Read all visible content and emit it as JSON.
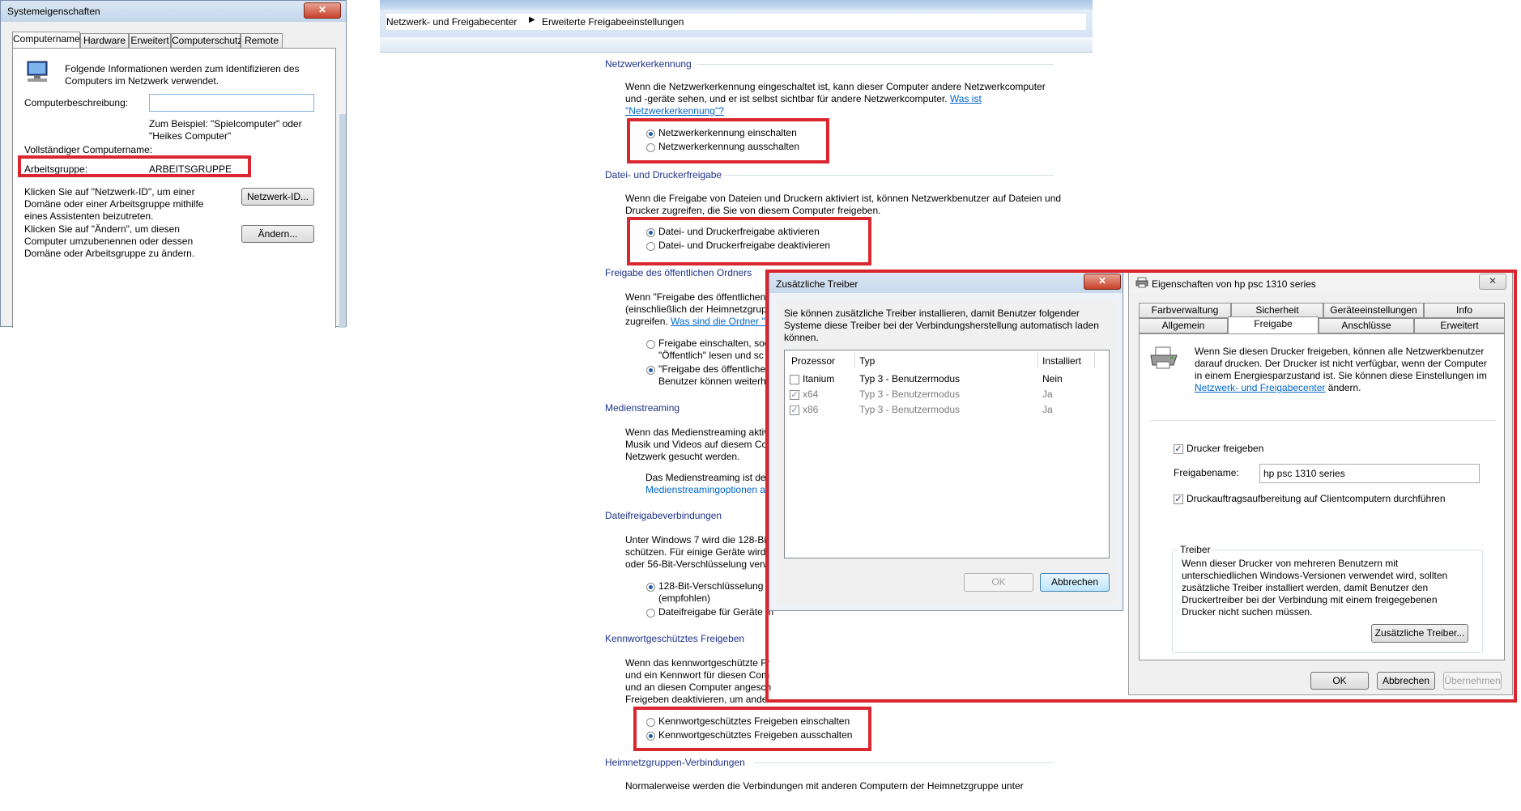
{
  "sys": {
    "title": "Systemeigenschaften",
    "close": "✕",
    "tabs": [
      "Computername",
      "Hardware",
      "Erweitert",
      "Computerschutz",
      "Remote"
    ],
    "info": "Folgende Informationen werden zum Identifizieren des Computers im Netzwerk verwendet.",
    "desc_label": "Computerbeschreibung:",
    "desc_value": "",
    "example": "Zum Beispiel: \"Spielcomputer\" oder \"Heikes Computer\"",
    "fullname_label": "Vollständiger Computername:",
    "workgroup_label": "Arbeitsgruppe:",
    "workgroup_value": "ARBEITSGRUPPE",
    "netid_text": "Klicken Sie auf \"Netzwerk-ID\", um einer Domäne oder einer Arbeitsgruppe mithilfe eines Assistenten beizutreten.",
    "netid_button": "Netzwerk-ID...",
    "change_text": "Klicken Sie auf \"Ändern\", um diesen Computer umzubenennen oder dessen Domäne oder Arbeitsgruppe zu ändern.",
    "change_button": "Ändern..."
  },
  "net": {
    "breadcrumb1": "Netzwerk- und Freigabecenter",
    "breadcrumb2": "Erweiterte Freigabeeinstellungen",
    "s1_title": "Netzwerkerkennung",
    "s1_text": "Wenn die Netzwerkerkennung eingeschaltet ist, kann dieser Computer andere Netzwerkcomputer und -geräte sehen, und er ist selbst sichtbar für andere Netzwerkcomputer.",
    "s1_link1": "Was ist",
    "s1_link2": "\"Netzwerkerkennung\"?",
    "s1_opt1": "Netzwerkerkennung einschalten",
    "s1_opt2": "Netzwerkerkennung ausschalten",
    "s2_title": "Datei- und Druckerfreigabe",
    "s2_text": "Wenn die Freigabe von Dateien und Druckern aktiviert ist, können Netzwerkbenutzer auf Dateien und Drucker zugreifen, die Sie von diesem Computer freigeben.",
    "s2_opt1": "Datei- und Druckerfreigabe aktivieren",
    "s2_opt2": "Datei- und Druckerfreigabe deaktivieren",
    "s3_title": "Freigabe des öffentlichen Ordners",
    "s3_l1": "Wenn \"Freigabe des öffentlichen",
    "s3_l2": "(einschließlich der Heimnetzgrup",
    "s3_l3": "zugreifen.",
    "s3_link": "Was sind die Ordner \"Ö",
    "s3_opt1a": "Freigabe einschalten, sod",
    "s3_opt1b": "\"Öffentlich\" lesen und sc",
    "s3_opt2a": "\"Freigabe des öffentliche",
    "s3_opt2b": "Benutzer können weiterh",
    "s4_title": "Medienstreaming",
    "s4_l1": "Wenn das Medienstreaming aktiv",
    "s4_l2": "Musik und Videos auf diesem Co",
    "s4_l3": "Netzwerk gesucht werden.",
    "s4_l4": "Das Medienstreaming ist dea",
    "s4_link": "Medienstreamingoptionen a",
    "s5_title": "Dateifreigabeverbindungen",
    "s5_l1": "Unter Windows 7 wird die 128-Bit",
    "s5_l2": "schützen. Für einige Geräte wird e",
    "s5_l3": "oder 56-Bit-Verschlüsselung verw",
    "s5_opt1a": "128-Bit-Verschlüsselung f",
    "s5_opt1b": "(empfohlen)",
    "s5_opt2": "Dateifreigabe für Geräte m",
    "s6_title": "Kennwortgeschütztes Freigeben",
    "s6_l1": "Wenn das kennwortgeschützte Fr",
    "s6_l2": "und ein Kennwort für diesen Com",
    "s6_l3": "und an diesen Computer angesch",
    "s6_l4": "Freigeben deaktivieren, um ande",
    "s6_opt1": "Kennwortgeschütztes Freigeben einschalten",
    "s6_opt2": "Kennwortgeschütztes Freigeben ausschalten",
    "s7_title": "Heimnetzgruppen-Verbindungen",
    "s7_l1": "Normalerweise werden die Verbindungen mit anderen Computern der Heimnetzgruppe unter"
  },
  "drv": {
    "title": "Zusätzliche Treiber",
    "close": "✕",
    "text": "Sie können zusätzliche Treiber installieren, damit Benutzer folgender Systeme diese Treiber bei der Verbindungsherstellung automatisch laden können.",
    "col1": "Prozessor",
    "col2": "Typ",
    "col3": "Installiert",
    "rows": [
      {
        "proc": "Itanium",
        "type": "Typ 3 - Benutzermodus",
        "inst": "Nein",
        "check": ""
      },
      {
        "proc": "x64",
        "type": "Typ 3 - Benutzermodus",
        "inst": "Ja",
        "check": "✓"
      },
      {
        "proc": "x86",
        "type": "Typ 3 - Benutzermodus",
        "inst": "Ja",
        "check": "✓"
      }
    ],
    "ok": "OK",
    "cancel": "Abbrechen"
  },
  "prn": {
    "title": "Eigenschaften von hp psc 1310 series",
    "close": "✕",
    "tabs_row1": [
      "Farbverwaltung",
      "Sicherheit",
      "Geräteeinstellungen",
      "Info"
    ],
    "tabs_row2": [
      "Allgemein",
      "Freigabe",
      "Anschlüsse",
      "Erweitert"
    ],
    "text": "Wenn Sie diesen Drucker freigeben, können alle Netzwerkbenutzer darauf drucken. Der Drucker ist nicht verfügbar, wenn der Computer in einem Energiesparzustand ist. Sie können diese Einstellungen im",
    "link": "Netzwerk- und Freigabecenter",
    "text_end": "ändern.",
    "share_check": "✓",
    "share_label": "Drucker freigeben",
    "name_label": "Freigabename:",
    "name_value": "hp psc 1310 series",
    "render_check": "✓",
    "render_label": "Druckauftragsaufbereitung auf Clientcomputern durchführen",
    "drv_group": "Treiber",
    "drv_text": "Wenn dieser Drucker von mehreren Benutzern mit unterschiedlichen Windows-Versionen verwendet wird, sollten zusätzliche Treiber installiert werden, damit Benutzer den Druckertreiber bei der Verbindung mit einem freigegebenen Drucker nicht suchen müssen.",
    "drv_button": "Zusätzliche Treiber...",
    "ok": "OK",
    "cancel": "Abbrechen",
    "apply": "Übernehmen"
  }
}
